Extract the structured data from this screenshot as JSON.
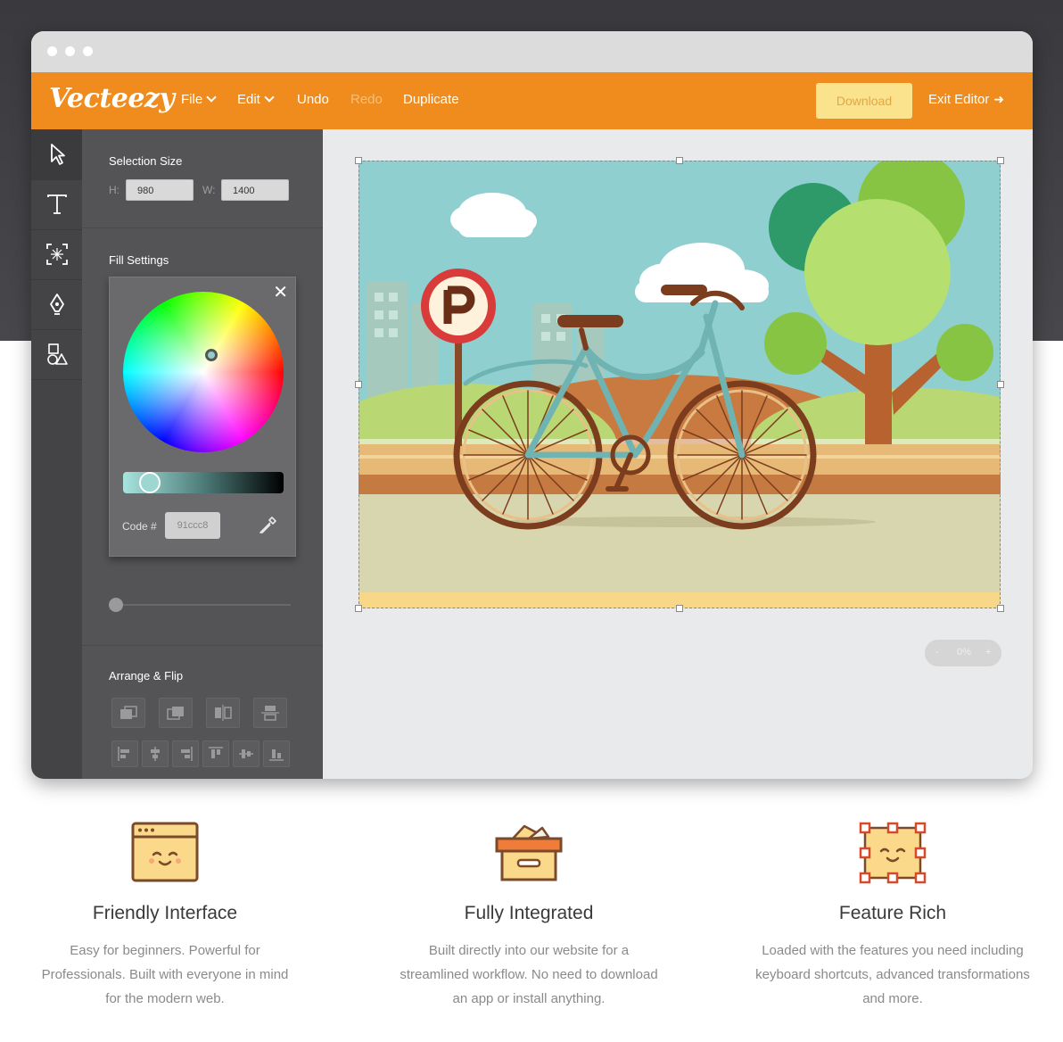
{
  "app": {
    "logo": "Vecteezy",
    "menu": {
      "file": "File",
      "edit": "Edit",
      "undo": "Undo",
      "redo": "Redo",
      "duplicate": "Duplicate",
      "download": "Download",
      "exit": "Exit Editor"
    }
  },
  "tools": [
    "select-tool-icon",
    "text-tool-icon",
    "trace-tool-icon",
    "pen-tool-icon",
    "shapes-tool-icon"
  ],
  "panel": {
    "selection_size": {
      "title": "Selection Size",
      "h_label": "H:",
      "h_value": "980",
      "w_label": "W:",
      "w_value": "1400"
    },
    "fill": {
      "title": "Fill Settings",
      "code_label": "Code #",
      "code_value": "91ccc8",
      "color": "#91ccc8"
    },
    "arrange": {
      "title": "Arrange & Flip"
    }
  },
  "canvas": {
    "zoom": {
      "minus": "-",
      "value": "0%",
      "plus": "+"
    }
  },
  "features": [
    {
      "title": "Friendly Interface",
      "desc": "Easy for beginners. Powerful for Professionals. Built with everyone in mind for the modern web."
    },
    {
      "title": "Fully Integrated",
      "desc": "Built directly into our website for a streamlined workflow. No need to download an app or install anything."
    },
    {
      "title": "Feature Rich",
      "desc": "Loaded with the features you need including keyboard shortcuts, advanced transformations and more."
    }
  ],
  "colors": {
    "brand": "#ef8c1d",
    "download_bg": "#fbe38e"
  }
}
